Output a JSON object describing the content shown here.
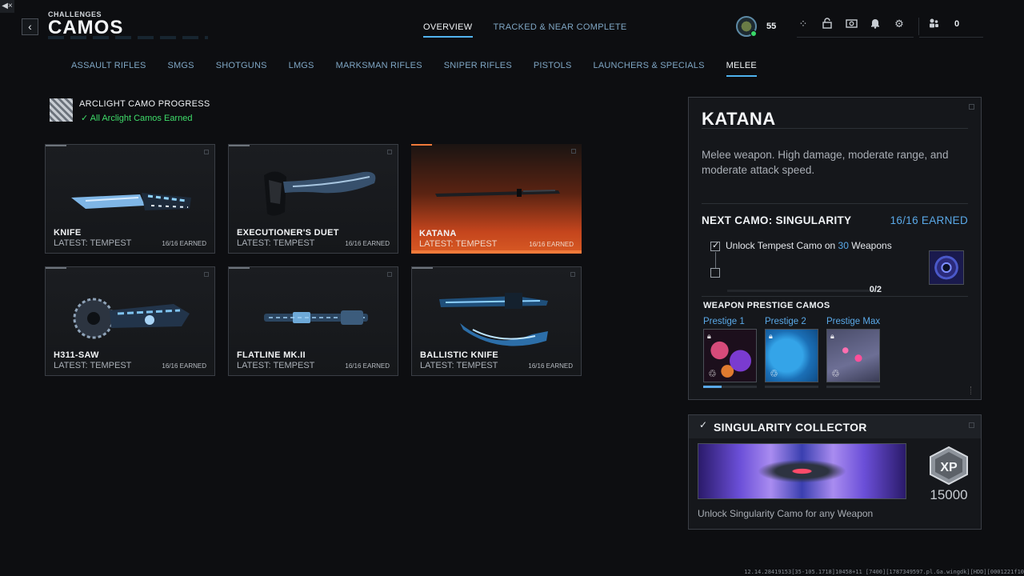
{
  "header": {
    "kicker": "CHALLENGES",
    "title": "CAMOS",
    "tabs": [
      {
        "label": "OVERVIEW",
        "active": true
      },
      {
        "label": "TRACKED & NEAR COMPLETE",
        "active": false
      }
    ]
  },
  "hud": {
    "level": "55",
    "friends_count": "0",
    "icons": [
      "grid-icon",
      "padlock-icon",
      "camera-icon",
      "bell-icon",
      "gear-icon"
    ]
  },
  "categories": [
    {
      "label": "ASSAULT RIFLES",
      "active": false
    },
    {
      "label": "SMGS",
      "active": false
    },
    {
      "label": "SHOTGUNS",
      "active": false
    },
    {
      "label": "LMGS",
      "active": false
    },
    {
      "label": "MARKSMAN RIFLES",
      "active": false
    },
    {
      "label": "SNIPER RIFLES",
      "active": false
    },
    {
      "label": "PISTOLS",
      "active": false
    },
    {
      "label": "LAUNCHERS & SPECIALS",
      "active": false
    },
    {
      "label": "MELEE",
      "active": true
    }
  ],
  "arclight": {
    "title": "ARCLIGHT CAMO PROGRESS",
    "status": "All Arclight Camos Earned"
  },
  "weapons": [
    {
      "name": "KNIFE",
      "latest": "LATEST: TEMPEST",
      "earned": "16/16 EARNED"
    },
    {
      "name": "EXECUTIONER'S DUET",
      "latest": "LATEST: TEMPEST",
      "earned": "16/16 EARNED"
    },
    {
      "name": "KATANA",
      "latest": "LATEST: TEMPEST",
      "earned": "16/16 EARNED"
    },
    {
      "name": "H311-SAW",
      "latest": "LATEST: TEMPEST",
      "earned": "16/16 EARNED"
    },
    {
      "name": "FLATLINE MK.II",
      "latest": "LATEST: TEMPEST",
      "earned": "16/16 EARNED"
    },
    {
      "name": "BALLISTIC KNIFE",
      "latest": "LATEST: TEMPEST",
      "earned": "16/16 EARNED"
    }
  ],
  "detail": {
    "title": "KATANA",
    "description": "Melee weapon. High damage, moderate range, and moderate attack speed.",
    "next_camo_label": "NEXT CAMO: SINGULARITY",
    "next_camo_earned": "16/16 EARNED",
    "task_prefix": "Unlock Tempest Camo on ",
    "task_count": "30",
    "task_suffix": " Weapons",
    "task_progress": "0/2",
    "prestige_title": "WEAPON PRESTIGE CAMOS",
    "prestige": [
      {
        "label": "Prestige 1",
        "progress": 0.35
      },
      {
        "label": "Prestige 2",
        "progress": 0
      },
      {
        "label": "Prestige Max",
        "progress": 0
      }
    ]
  },
  "collector": {
    "title": "SINGULARITY COLLECTOR",
    "xp_label": "XP",
    "xp_amount": "15000",
    "description": "Unlock Singularity Camo for any Weapon"
  },
  "build_string": "12.14.28419153[35-105.1718]10458+11 [7400][1787349597.pl.Ga.wingdk][HDD][0001221f10"
}
